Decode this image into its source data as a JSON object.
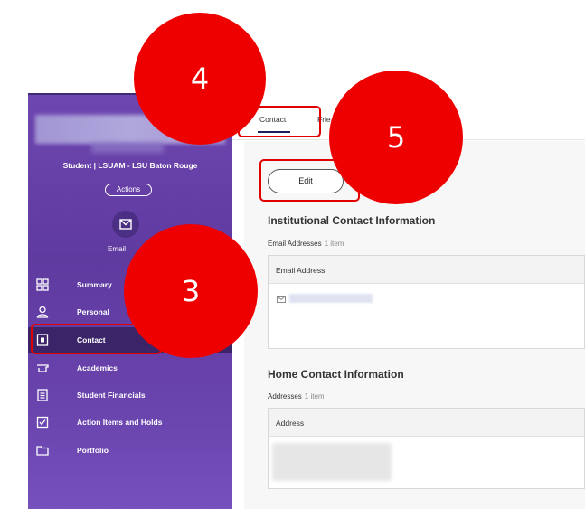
{
  "sidebar": {
    "role": "Student | LSUAM - LSU Baton Rouge",
    "actions_label": "Actions",
    "email_label": "Email",
    "items": [
      {
        "label": "Summary",
        "icon": "grid-icon"
      },
      {
        "label": "Personal",
        "icon": "person-icon"
      },
      {
        "label": "Contact",
        "icon": "contact-card-icon",
        "active": true
      },
      {
        "label": "Academics",
        "icon": "graduation-cap-icon"
      },
      {
        "label": "Student Financials",
        "icon": "document-list-icon"
      },
      {
        "label": "Action Items and Holds",
        "icon": "checkbox-icon"
      },
      {
        "label": "Portfolio",
        "icon": "folder-icon"
      }
    ]
  },
  "tabs": [
    {
      "label": "Contact",
      "active": true
    },
    {
      "label": "Frie"
    }
  ],
  "main": {
    "edit_label": "Edit",
    "institutional": {
      "title": "Institutional Contact Information",
      "emails_label": "Email Addresses",
      "emails_count": "1 item",
      "column": "Email Address"
    },
    "home": {
      "title": "Home Contact Information",
      "addresses_label": "Addresses",
      "addresses_count": "1 item",
      "column": "Address"
    }
  },
  "callouts": {
    "one": "3",
    "two": "4",
    "three": "5"
  },
  "colors": {
    "sidebar": "#6a44ad",
    "active_nav": "#3b2468",
    "callout": "#ef0000"
  }
}
